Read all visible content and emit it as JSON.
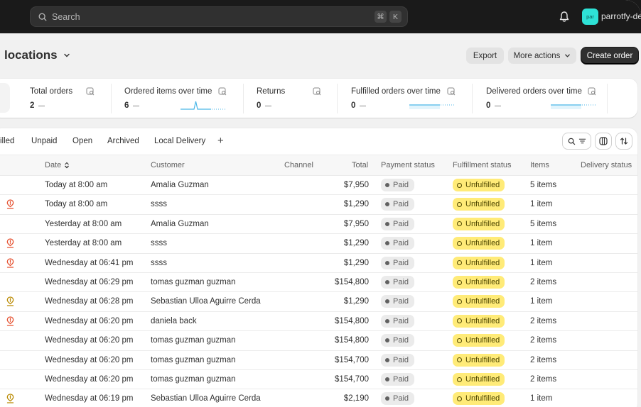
{
  "topbar": {
    "search_placeholder": "Search",
    "shortcut_keys": [
      "⌘",
      "K"
    ],
    "notification_icon": "bell-icon",
    "avatar_initials": "par",
    "store_name": "parrotfy-dev"
  },
  "header": {
    "title": "locations",
    "export_label": "Export",
    "more_actions_label": "More actions",
    "create_order_label": "Create order"
  },
  "metrics": [
    {
      "label": "Total orders",
      "value": "2",
      "trend": "—",
      "has_sparkline": false
    },
    {
      "label": "Ordered items over time",
      "value": "6",
      "trend": "—",
      "has_sparkline": true,
      "sparkline": "spike"
    },
    {
      "label": "Returns",
      "value": "0",
      "trend": "—",
      "has_sparkline": false
    },
    {
      "label": "Fulfilled orders over time",
      "value": "0",
      "trend": "—",
      "has_sparkline": true,
      "sparkline": "flat"
    },
    {
      "label": "Delivered orders over time",
      "value": "0",
      "trend": "—",
      "has_sparkline": true,
      "sparkline": "flat"
    }
  ],
  "colors": {
    "sparkline": "#4bb7e8",
    "alert_red": "#e5502f",
    "alert_yellow": "#b98900",
    "unfulfilled_bg": "#ffeb78",
    "avatar_bg": "#2ee2d6"
  },
  "tabs": [
    "illed",
    "Unpaid",
    "Open",
    "Archived",
    "Local Delivery",
    "+"
  ],
  "table": {
    "columns": [
      "Date",
      "Customer",
      "Channel",
      "Total",
      "Payment status",
      "Fulfillment status",
      "Items",
      "Delivery status"
    ],
    "rows": [
      {
        "alert": "",
        "date": "Today at 8:00 am",
        "customer": "Amalia Guzman",
        "channel": "",
        "total": "$7,950",
        "payment": "Paid",
        "fulfillment": "Unfulfilled",
        "items": "5 items",
        "delivery": ""
      },
      {
        "alert": "red",
        "date": "Today at 8:00 am",
        "customer": "ssss",
        "channel": "",
        "total": "$1,290",
        "payment": "Paid",
        "fulfillment": "Unfulfilled",
        "items": "1 item",
        "delivery": ""
      },
      {
        "alert": "",
        "date": "Yesterday at 8:00 am",
        "customer": "Amalia Guzman",
        "channel": "",
        "total": "$7,950",
        "payment": "Paid",
        "fulfillment": "Unfulfilled",
        "items": "5 items",
        "delivery": ""
      },
      {
        "alert": "red",
        "date": "Yesterday at 8:00 am",
        "customer": "ssss",
        "channel": "",
        "total": "$1,290",
        "payment": "Paid",
        "fulfillment": "Unfulfilled",
        "items": "1 item",
        "delivery": ""
      },
      {
        "alert": "red",
        "date": "Wednesday at 06:41 pm",
        "customer": "ssss",
        "channel": "",
        "total": "$1,290",
        "payment": "Paid",
        "fulfillment": "Unfulfilled",
        "items": "1 item",
        "delivery": ""
      },
      {
        "alert": "",
        "date": "Wednesday at 06:29 pm",
        "customer": "tomas guzman guzman",
        "channel": "",
        "total": "$154,800",
        "payment": "Paid",
        "fulfillment": "Unfulfilled",
        "items": "2 items",
        "delivery": ""
      },
      {
        "alert": "yellow",
        "date": "Wednesday at 06:28 pm",
        "customer": "Sebastian Ulloa Aguirre Cerda",
        "channel": "",
        "total": "$1,290",
        "payment": "Paid",
        "fulfillment": "Unfulfilled",
        "items": "1 item",
        "delivery": ""
      },
      {
        "alert": "red",
        "date": "Wednesday at 06:20 pm",
        "customer": "daniela back",
        "channel": "",
        "total": "$154,800",
        "payment": "Paid",
        "fulfillment": "Unfulfilled",
        "items": "2 items",
        "delivery": ""
      },
      {
        "alert": "",
        "date": "Wednesday at 06:20 pm",
        "customer": "tomas guzman guzman",
        "channel": "",
        "total": "$154,800",
        "payment": "Paid",
        "fulfillment": "Unfulfilled",
        "items": "2 items",
        "delivery": ""
      },
      {
        "alert": "",
        "date": "Wednesday at 06:20 pm",
        "customer": "tomas guzman guzman",
        "channel": "",
        "total": "$154,700",
        "payment": "Paid",
        "fulfillment": "Unfulfilled",
        "items": "2 items",
        "delivery": ""
      },
      {
        "alert": "",
        "date": "Wednesday at 06:20 pm",
        "customer": "tomas guzman guzman",
        "channel": "",
        "total": "$154,700",
        "payment": "Paid",
        "fulfillment": "Unfulfilled",
        "items": "2 items",
        "delivery": ""
      },
      {
        "alert": "yellow",
        "date": "Wednesday at 06:19 pm",
        "customer": "Sebastian Ulloa Aguirre Cerda",
        "channel": "",
        "total": "$2,190",
        "payment": "Paid",
        "fulfillment": "Unfulfilled",
        "items": "1 item",
        "delivery": ""
      }
    ]
  }
}
